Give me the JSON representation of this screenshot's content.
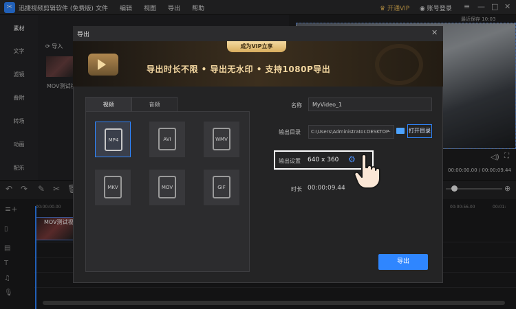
{
  "app": {
    "title": "迅捷视频剪辑软件 (免费版)",
    "menu": [
      "文件",
      "编辑",
      "视图",
      "导出",
      "帮助"
    ],
    "vip_label": "开通VIP",
    "login_label": "账号登录",
    "autosave": "最近保存 10:03"
  },
  "sidebar": {
    "items": [
      {
        "label": "素材"
      },
      {
        "label": "文字"
      },
      {
        "label": "滤镜"
      },
      {
        "label": "叠附"
      },
      {
        "label": "转场"
      },
      {
        "label": "动画"
      },
      {
        "label": "配乐"
      }
    ]
  },
  "media": {
    "import_label": "导入",
    "clip_name": "MOV测试视"
  },
  "preview": {
    "timecode": "00:00:00.00 / 00:00:09.44"
  },
  "timeline": {
    "ruler": [
      "00:00:00.00",
      "00:00:56.00",
      "00:01:"
    ],
    "clip_label": "MOV测试视"
  },
  "dialog": {
    "title": "导出",
    "banner_badge": "成为VIP立享",
    "banner_text": "导出时长不限 • 导出无水印 • 支持1080P导出",
    "tabs": [
      "视频",
      "音频"
    ],
    "formats": [
      "MP4",
      "AVI",
      "WMV",
      "MKV",
      "MOV",
      "GIF"
    ],
    "selected_format": "MP4",
    "name_label": "名称",
    "name_value": "MyVideo_1",
    "dir_label": "输出目录",
    "dir_value": "C:\\Users\\Administrator.DESKTOP-",
    "open_dir_label": "打开目录",
    "settings_label": "输出设置",
    "resolution": "640 x 360",
    "duration_label": "时长",
    "duration_value": "00:00:09.44",
    "export_label": "导出"
  },
  "colors": {
    "accent": "#2f86ff",
    "vip": "#e9b955",
    "banner_text": "#f2d6a0"
  }
}
